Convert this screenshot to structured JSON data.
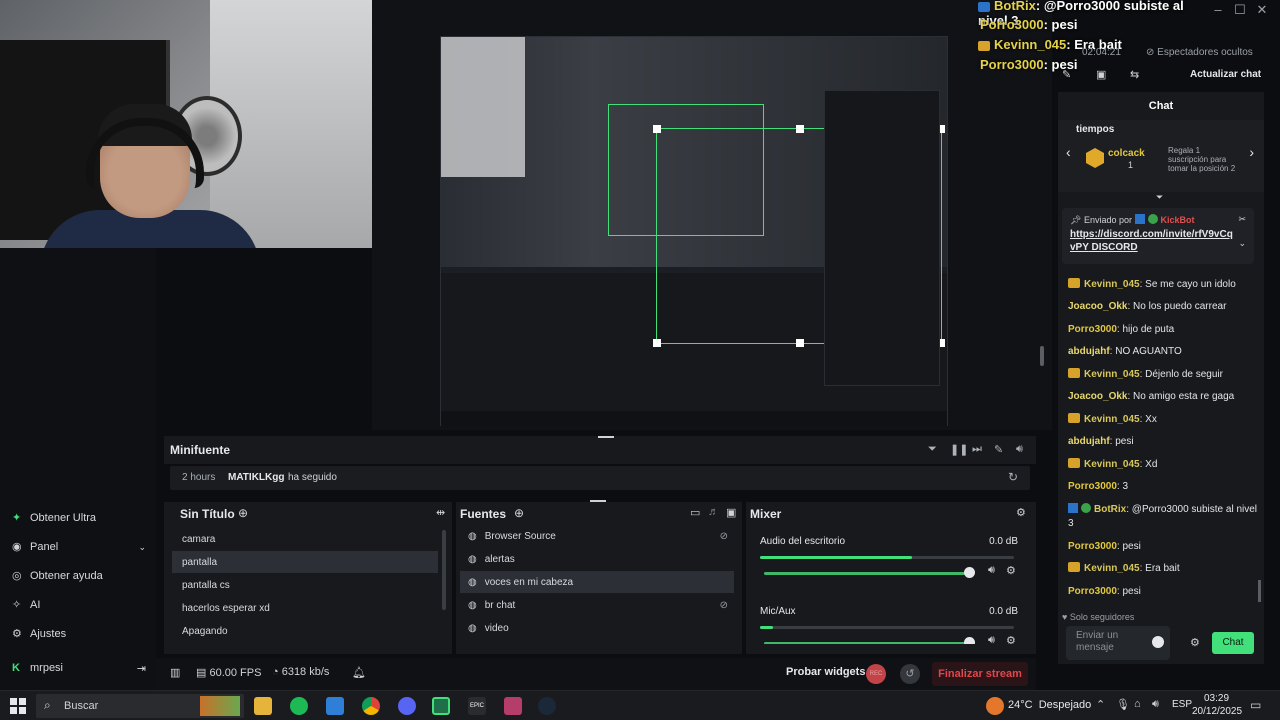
{
  "overlay_chat": [
    {
      "user": "BotRix",
      "text": ": @Porro3000 subiste al nivel 3"
    },
    {
      "user": "Porro3000",
      "text": ": pesi"
    },
    {
      "user": "Kevinn_045",
      "text": ": Era bait"
    },
    {
      "user": "Porro3000",
      "text": ": pesi"
    }
  ],
  "stream_info": {
    "uptime": "02:04:21",
    "viewers_hidden": "Espectadores ocultos",
    "refresh_chat": "Actualizar chat"
  },
  "chat": {
    "title": "Chat",
    "pinned_header": "tiempos",
    "gift_user": "colcack",
    "gift_count": "1",
    "gift_text": "Regala 1 suscripción para tomar la posición 2",
    "sent_by_label": "Enviado por",
    "sent_by_user": "KickBot",
    "pinned_link": "https://discord.com/invite/rfV9vCqvPY",
    "pinned_suffix": "DISCORD",
    "messages": [
      {
        "user": "Kevinn_045",
        "text": ": Se me cayo un idolo",
        "badge": "crown"
      },
      {
        "user": "Joacoo_Okk",
        "text": ": No los puedo carrear",
        "badge": ""
      },
      {
        "user": "Porro3000",
        "text": ": hijo de puta",
        "badge": ""
      },
      {
        "user": "abdujahf",
        "text": ": NO AGUANTO",
        "badge": ""
      },
      {
        "user": "Kevinn_045",
        "text": ": Déjenlo de seguir",
        "badge": "crown"
      },
      {
        "user": "Joacoo_Okk",
        "text": ": No amigo esta re gaga",
        "badge": ""
      },
      {
        "user": "Kevinn_045",
        "text": ": Xx",
        "badge": "crown"
      },
      {
        "user": "abdujahf",
        "text": ": pesi",
        "badge": ""
      },
      {
        "user": "Kevinn_045",
        "text": ": Xd",
        "badge": "crown"
      },
      {
        "user": "Porro3000",
        "text": ": 3",
        "badge": ""
      },
      {
        "user": "BotRix",
        "text": ": @Porro3000 subiste al nivel 3",
        "badge": "bot"
      },
      {
        "user": "Porro3000",
        "text": ": pesi",
        "badge": ""
      },
      {
        "user": "Kevinn_045",
        "text": ": Era bait",
        "badge": "crown"
      },
      {
        "user": "Porro3000",
        "text": ": pesi",
        "badge": ""
      }
    ],
    "followers_only": "Solo seguidores",
    "input_placeholder": "Enviar un mensaje",
    "send_button": "Chat"
  },
  "sidebar": {
    "items": [
      {
        "label": "Obtener Ultra",
        "icon": "ultra-icon"
      },
      {
        "label": "Panel",
        "icon": "panel-icon"
      },
      {
        "label": "Obtener ayuda",
        "icon": "help-icon"
      },
      {
        "label": "AI",
        "icon": "ai-icon"
      },
      {
        "label": "Ajustes",
        "icon": "settings-icon"
      }
    ],
    "user": "mrpesi"
  },
  "minifuente": {
    "title": "Minifuente",
    "recent_time": "2 hours",
    "recent_user": "MATIKLKgg",
    "recent_action": "ha seguido"
  },
  "scenes": {
    "title": "Sin Título",
    "items": [
      "camara",
      "pantalla",
      "pantalla cs",
      "hacerlos esperar xd",
      "Apagando"
    ],
    "selected": 1
  },
  "sources": {
    "title": "Fuentes",
    "items": [
      "Browser Source",
      "alertas",
      "voces en mi cabeza",
      "br chat",
      "video"
    ],
    "selected": 2
  },
  "mixer": {
    "title": "Mixer",
    "channels": [
      {
        "name": "Audio del escritorio",
        "db": "0.0 dB",
        "level": 0.6
      },
      {
        "name": "Mic/Aux",
        "db": "0.0 dB",
        "level": 0.05
      }
    ]
  },
  "statusbar": {
    "fps": "60.00 FPS",
    "bitrate": "6318 kb/s",
    "test_widgets": "Probar widgets",
    "rec_label": "REC",
    "end_stream": "Finalizar stream"
  },
  "taskbar": {
    "search": "Buscar",
    "weather": "24°C  Despejado",
    "lang": "ESP",
    "time": "03:29",
    "date": "20/12/2025"
  },
  "colors": {
    "accent": "#41e07a",
    "end_stream": "#e0474c"
  }
}
